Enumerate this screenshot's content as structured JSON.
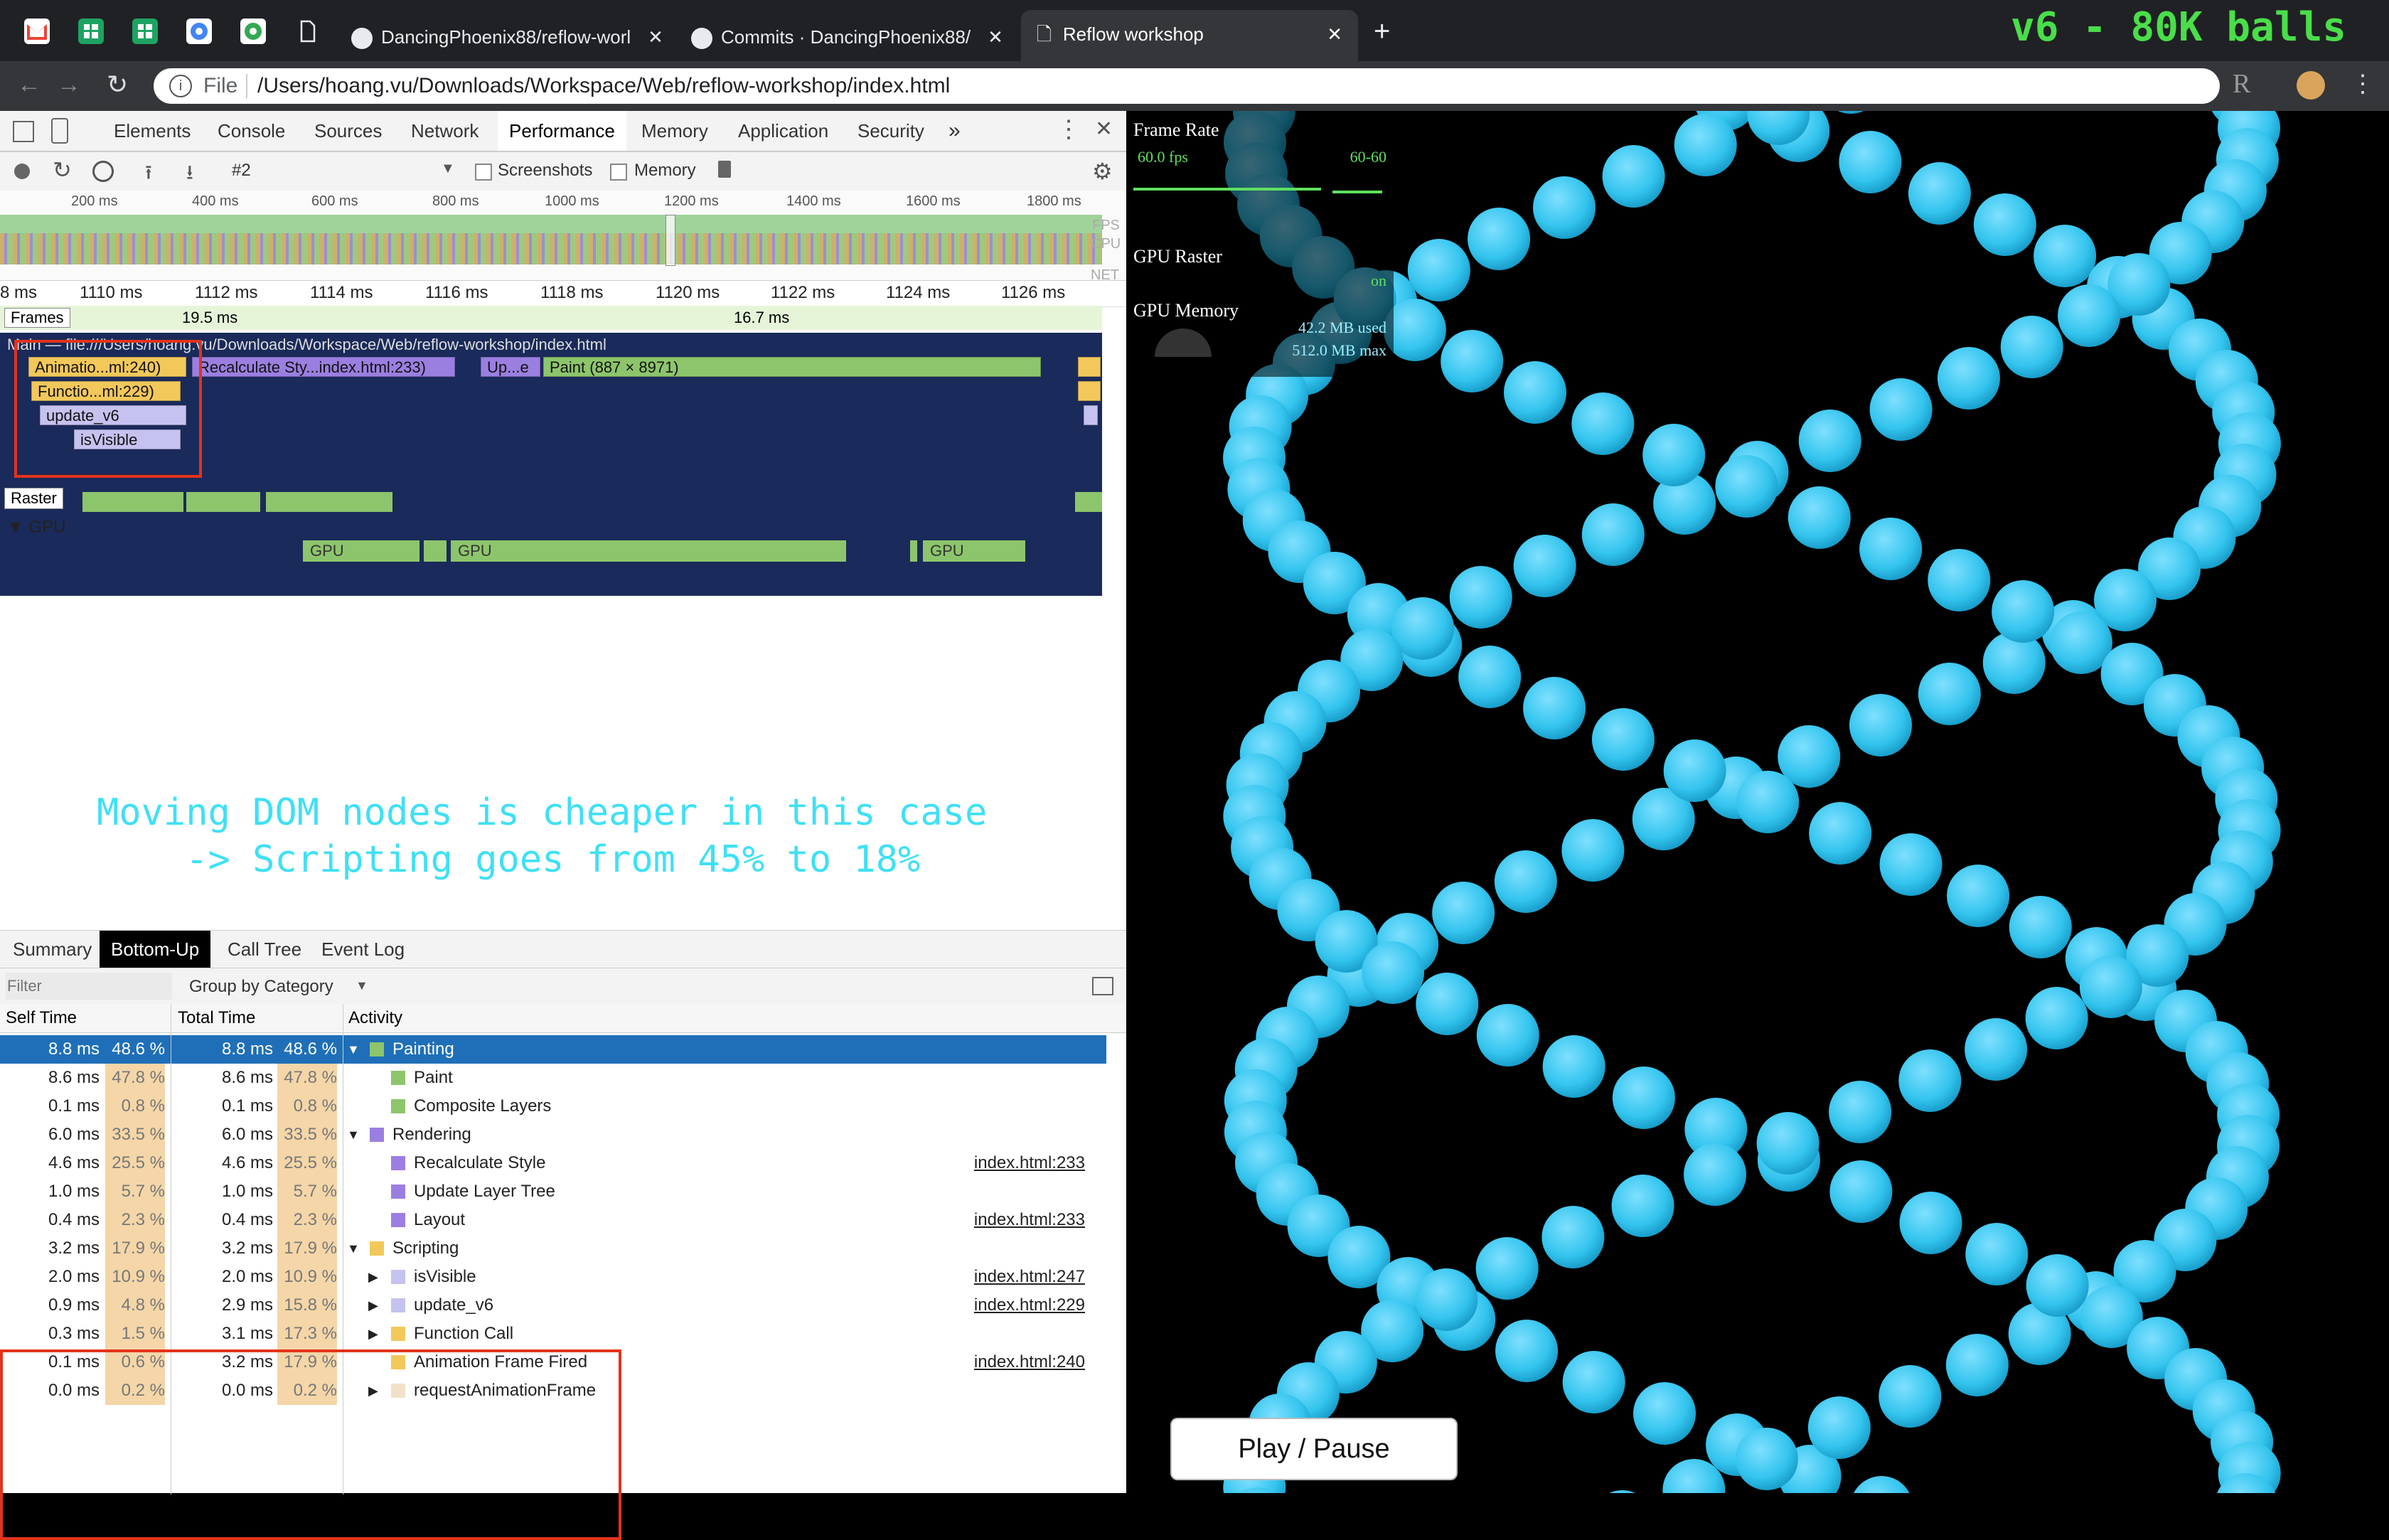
{
  "browser": {
    "tabs": [
      {
        "label": "DancingPhoenix88/reflow-worl"
      },
      {
        "label": "Commits · DancingPhoenix88/"
      },
      {
        "label": "Reflow workshop"
      }
    ],
    "address_prefix": "File",
    "address": "/Users/hoang.vu/Downloads/Workspace/Web/reflow-workshop/index.html"
  },
  "headline": "v6 - 80K balls",
  "devtools": {
    "tabs": [
      "Elements",
      "Console",
      "Sources",
      "Network",
      "Performance",
      "Memory",
      "Application",
      "Security",
      "»"
    ],
    "active_tab": "Performance",
    "recording_select": "#2",
    "screenshots_label": "Screenshots",
    "memory_label": "Memory",
    "overview_ticks": [
      "200 ms",
      "400 ms",
      "600 ms",
      "800 ms",
      "1000 ms",
      "1200 ms",
      "1400 ms",
      "1600 ms",
      "1800 ms"
    ],
    "overview_labels": {
      "fps": "FPS",
      "cpu": "CPU",
      "net": "NET"
    },
    "ms_ticks": [
      "8 ms",
      "1110 ms",
      "1112 ms",
      "1114 ms",
      "1116 ms",
      "1118 ms",
      "1120 ms",
      "1122 ms",
      "1124 ms",
      "1126 ms"
    ],
    "frames": {
      "label": "Frames",
      "f1": "19.5 ms",
      "f2": "16.7 ms"
    },
    "main_label": "Main — file:///Users/hoang.vu/Downloads/Workspace/Web/reflow-workshop/index.html",
    "flame": {
      "animation": "Animatio...ml:240)",
      "recalc": "Recalculate Sty...index.html:233)",
      "update": "Up...e",
      "paint": "Paint (887 × 8971)",
      "function": "Functio...ml:229)",
      "update_v6": "update_v6",
      "isvisible": "isVisible"
    },
    "raster_label": "Raster",
    "gpu_label": "GPU",
    "gpu_bars": [
      "GPU",
      "GPU",
      "GPU"
    ],
    "caption_line1": "Moving DOM nodes is cheaper in this case",
    "caption_line2": "    -> Scripting goes from 45% to 18%",
    "bottom_tabs": [
      "Summary",
      "Bottom-Up",
      "Call Tree",
      "Event Log"
    ],
    "active_bottom_tab": "Bottom-Up",
    "filter_placeholder": "Filter",
    "group_by": "Group by Category",
    "columns": {
      "self": "Self Time",
      "total": "Total Time",
      "activity": "Activity"
    },
    "rows": [
      {
        "self": "8.8 ms",
        "self_pct": "48.6 %",
        "total": "8.8 ms",
        "total_pct": "48.6 %",
        "activity": "Painting",
        "color": "#8dc56c",
        "depth": 0,
        "expander": "▼",
        "link": "",
        "selected": true
      },
      {
        "self": "8.6 ms",
        "self_pct": "47.8 %",
        "total": "8.6 ms",
        "total_pct": "47.8 %",
        "activity": "Paint",
        "color": "#8dc56c",
        "depth": 1,
        "expander": "",
        "link": ""
      },
      {
        "self": "0.1 ms",
        "self_pct": "0.8 %",
        "total": "0.1 ms",
        "total_pct": "0.8 %",
        "activity": "Composite Layers",
        "color": "#8dc56c",
        "depth": 1,
        "expander": "",
        "link": ""
      },
      {
        "self": "6.0 ms",
        "self_pct": "33.5 %",
        "total": "6.0 ms",
        "total_pct": "33.5 %",
        "activity": "Rendering",
        "color": "#9a7fe0",
        "depth": 0,
        "expander": "▼",
        "link": ""
      },
      {
        "self": "4.6 ms",
        "self_pct": "25.5 %",
        "total": "4.6 ms",
        "total_pct": "25.5 %",
        "activity": "Recalculate Style",
        "color": "#9a7fe0",
        "depth": 1,
        "expander": "",
        "link": "index.html:233"
      },
      {
        "self": "1.0 ms",
        "self_pct": "5.7 %",
        "total": "1.0 ms",
        "total_pct": "5.7 %",
        "activity": "Update Layer Tree",
        "color": "#9a7fe0",
        "depth": 1,
        "expander": "",
        "link": ""
      },
      {
        "self": "0.4 ms",
        "self_pct": "2.3 %",
        "total": "0.4 ms",
        "total_pct": "2.3 %",
        "activity": "Layout",
        "color": "#9a7fe0",
        "depth": 1,
        "expander": "",
        "link": "index.html:233"
      },
      {
        "self": "3.2 ms",
        "self_pct": "17.9 %",
        "total": "3.2 ms",
        "total_pct": "17.9 %",
        "activity": "Scripting",
        "color": "#f2c85b",
        "depth": 0,
        "expander": "▼",
        "link": ""
      },
      {
        "self": "2.0 ms",
        "self_pct": "10.9 %",
        "total": "2.0 ms",
        "total_pct": "10.9 %",
        "activity": "isVisible",
        "color": "#c6c2f0",
        "depth": 1,
        "expander": "▶",
        "link": "index.html:247"
      },
      {
        "self": "0.9 ms",
        "self_pct": "4.8 %",
        "total": "2.9 ms",
        "total_pct": "15.8 %",
        "activity": "update_v6",
        "color": "#c6c2f0",
        "depth": 1,
        "expander": "▶",
        "link": "index.html:229"
      },
      {
        "self": "0.3 ms",
        "self_pct": "1.5 %",
        "total": "3.1 ms",
        "total_pct": "17.3 %",
        "activity": "Function Call",
        "color": "#f2c85b",
        "depth": 1,
        "expander": "▶",
        "link": ""
      },
      {
        "self": "0.1 ms",
        "self_pct": "0.6 %",
        "total": "3.2 ms",
        "total_pct": "17.9 %",
        "activity": "Animation Frame Fired",
        "color": "#f2c85b",
        "depth": 1,
        "expander": "",
        "link": "index.html:240"
      },
      {
        "self": "0.0 ms",
        "self_pct": "0.2 %",
        "total": "0.0 ms",
        "total_pct": "0.2 %",
        "activity": "requestAnimationFrame",
        "color": "#efe2c9",
        "depth": 1,
        "expander": "▶",
        "link": ""
      }
    ]
  },
  "fps_meter": {
    "title": "Frame Rate",
    "fps": "60.0 fps",
    "range": "60-60",
    "gpu_raster": "GPU Raster",
    "gpu_raster_state": "on",
    "gpu_memory": "GPU Memory",
    "mem_used": "42.2 MB used",
    "mem_max": "512.0 MB max"
  },
  "page": {
    "play_pause": "Play / Pause",
    "ball_color": "#33c4ee"
  }
}
